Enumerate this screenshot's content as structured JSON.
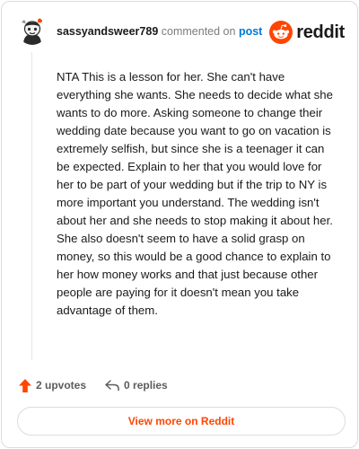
{
  "header": {
    "username": "sassyandsweer789",
    "action_text": "commented on",
    "post_link": "post",
    "brand": "reddit"
  },
  "comment": {
    "body": "NTA This is a lesson for her. She can't have everything she wants. She needs to decide what she wants to do more. Asking someone to change their wedding date because you want to go on vacation is extremely selfish, but since she is a teenager it can be expected. Explain to her that you would love for her to be part of your wedding but if the trip to NY is more important you understand. The wedding isn't about her and she needs to stop making it about her. She also doesn't seem to have a solid grasp on money, so this would be a good chance to explain to her how money works and that just because other people are paying for it doesn't mean you take advantage of them."
  },
  "footer": {
    "upvotes": "2 upvotes",
    "replies": "0 replies"
  },
  "view_more": "View more on Reddit",
  "icons": {
    "avatar": "user-avatar",
    "brand": "reddit-snoo-icon",
    "upvote": "upvote-arrow-icon",
    "reply": "reply-arrow-icon"
  },
  "colors": {
    "brand_orange": "#ff4500",
    "link_blue": "#0079d3",
    "muted": "#7c7c7c"
  }
}
